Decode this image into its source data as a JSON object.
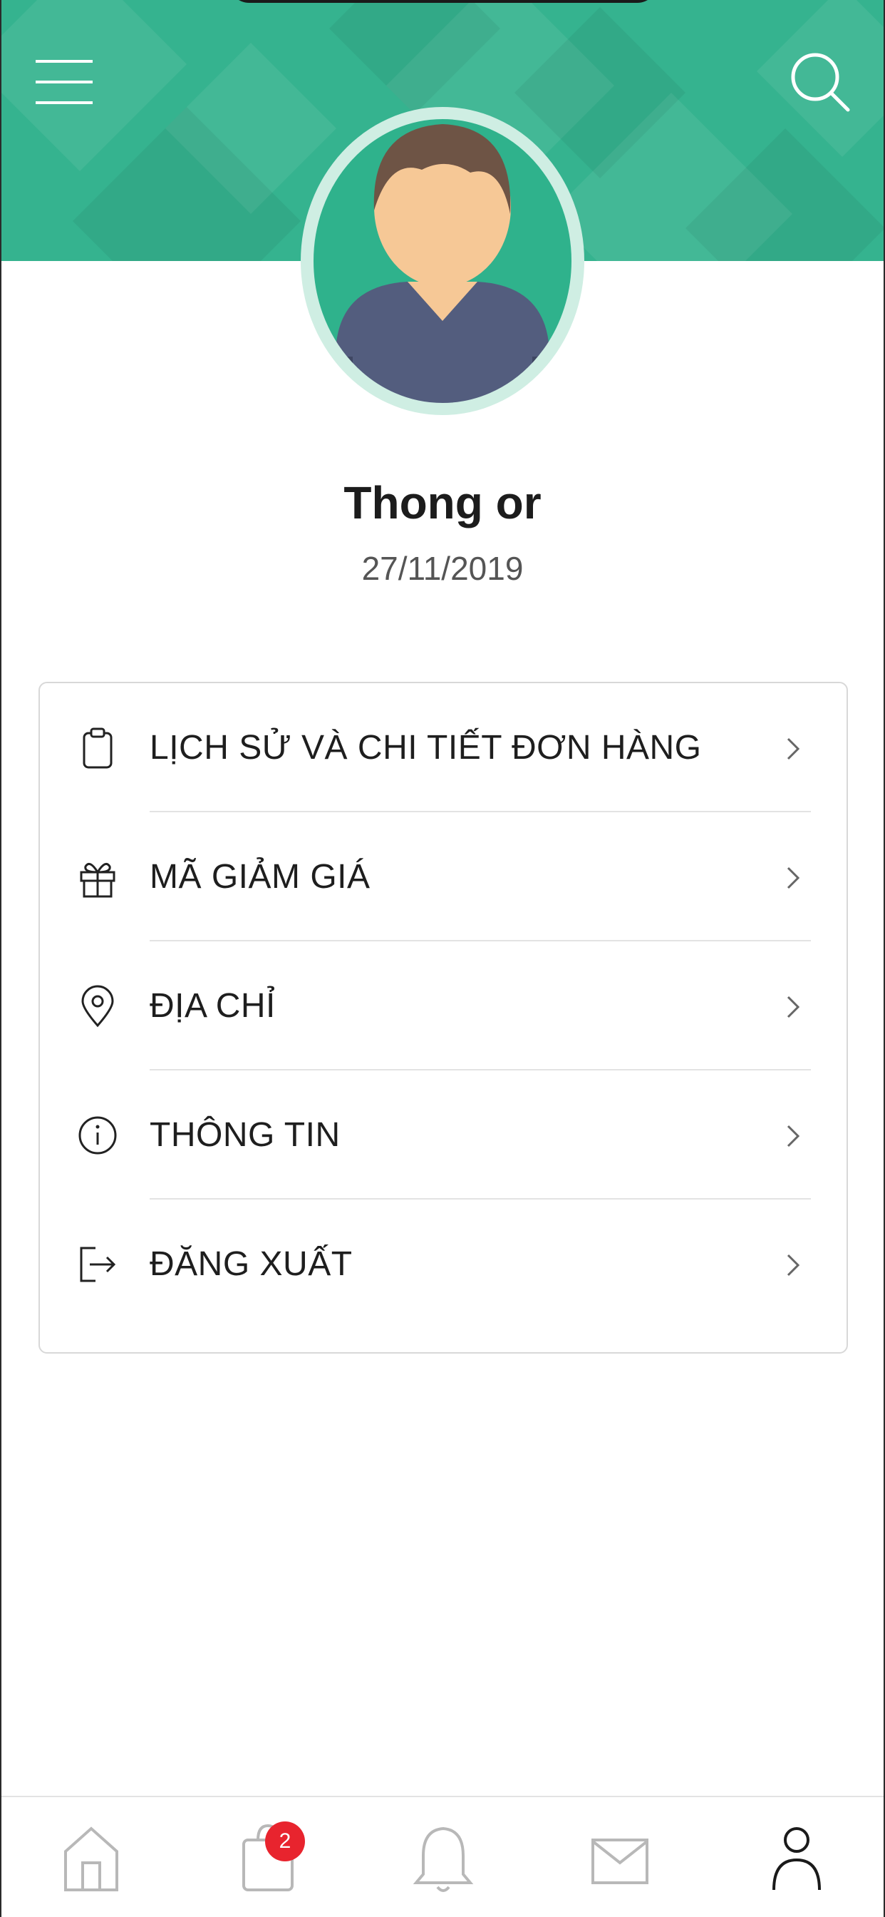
{
  "header": {
    "menu_icon": "hamburger-menu-icon",
    "search_icon": "search-icon",
    "accent_color": "#35b38f"
  },
  "profile": {
    "avatar_icon": "user-avatar",
    "name": "Thong or",
    "date": "27/11/2019"
  },
  "menu": {
    "items": [
      {
        "label": "LỊCH SỬ VÀ CHI TIẾT ĐƠN HÀNG",
        "icon": "clipboard-icon"
      },
      {
        "label": "MÃ GIẢM GIÁ",
        "icon": "gift-icon"
      },
      {
        "label": "ĐỊA CHỈ",
        "icon": "location-pin-icon"
      },
      {
        "label": "THÔNG TIN",
        "icon": "info-icon"
      },
      {
        "label": "ĐĂNG XUẤT",
        "icon": "logout-icon"
      }
    ]
  },
  "tabbar": {
    "tabs": [
      {
        "name": "home",
        "icon": "home-icon"
      },
      {
        "name": "cart",
        "icon": "shopping-bag-icon",
        "badge": "2"
      },
      {
        "name": "notifications",
        "icon": "bell-icon"
      },
      {
        "name": "messages",
        "icon": "mail-icon"
      },
      {
        "name": "account",
        "icon": "user-icon",
        "active": true
      }
    ],
    "badge_color": "#e8242e"
  }
}
